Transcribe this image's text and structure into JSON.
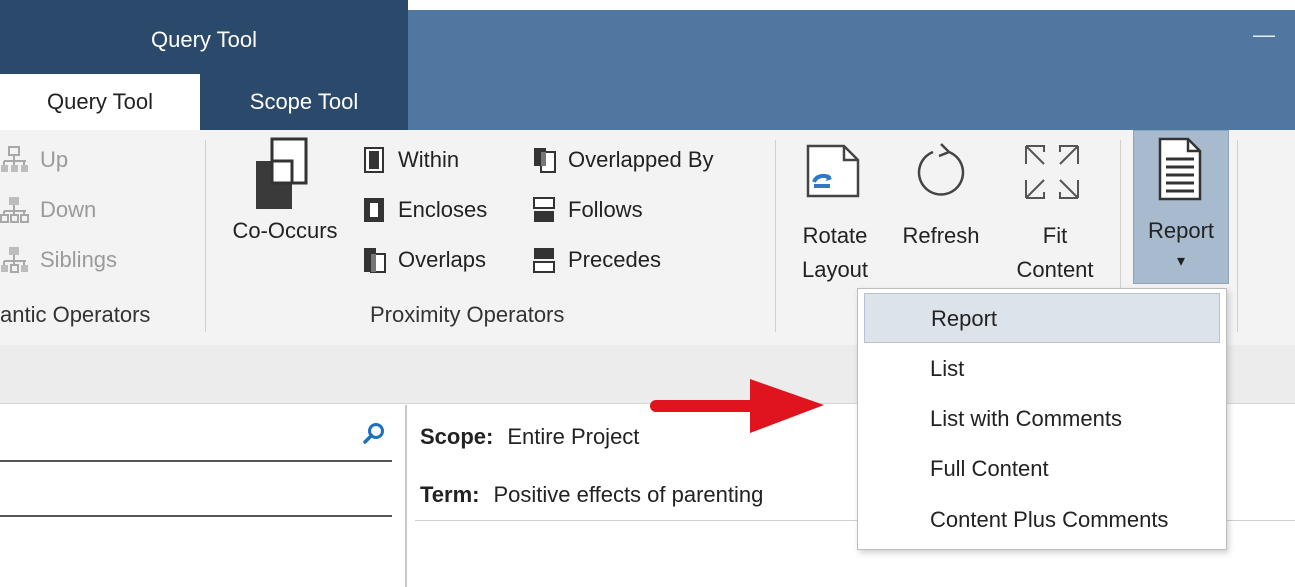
{
  "window": {
    "tool_group_title": "Query Tool",
    "minimize_glyph": "—"
  },
  "tabs": [
    {
      "label": "Query Tool",
      "active": true
    },
    {
      "label": "Scope Tool",
      "active": false
    }
  ],
  "ribbon": {
    "semantic": {
      "label": "antic Operators",
      "items": [
        {
          "label": "Up",
          "icon": "hierarchy-up-icon",
          "enabled": false
        },
        {
          "label": "Down",
          "icon": "hierarchy-down-icon",
          "enabled": false
        },
        {
          "label": "Siblings",
          "icon": "hierarchy-siblings-icon",
          "enabled": false
        }
      ]
    },
    "proximity": {
      "label": "Proximity Operators",
      "co_occurs": "Co-Occurs",
      "col1": [
        {
          "label": "Within",
          "icon": "within-icon"
        },
        {
          "label": "Encloses",
          "icon": "encloses-icon"
        },
        {
          "label": "Overlaps",
          "icon": "overlaps-icon"
        }
      ],
      "col2": [
        {
          "label": "Overlapped By",
          "icon": "overlapped-by-icon"
        },
        {
          "label": "Follows",
          "icon": "follows-icon"
        },
        {
          "label": "Precedes",
          "icon": "precedes-icon"
        }
      ]
    },
    "layout": {
      "rotate": [
        "Rotate",
        "Layout"
      ],
      "refresh": "Refresh",
      "fit": [
        "Fit",
        "Content"
      ]
    },
    "report": {
      "label": "Report",
      "dropdown_glyph": "▾"
    }
  },
  "report_menu": {
    "items": [
      {
        "label": "Report",
        "selected": true
      },
      {
        "label": "List",
        "selected": false
      },
      {
        "label": "List with Comments",
        "selected": false
      },
      {
        "label": "Full Content",
        "selected": false
      },
      {
        "label": "Content Plus Comments",
        "selected": false
      }
    ]
  },
  "content": {
    "search_value": "",
    "scope_label": "Scope:",
    "scope_value": "Entire Project",
    "term_label": "Term:",
    "term_value": "Positive effects of parenting"
  },
  "colors": {
    "title_dark": "#2b4a6b",
    "title_blue": "#4f77a0",
    "report_active": "#a8bace",
    "arrow": "#e0141e"
  }
}
